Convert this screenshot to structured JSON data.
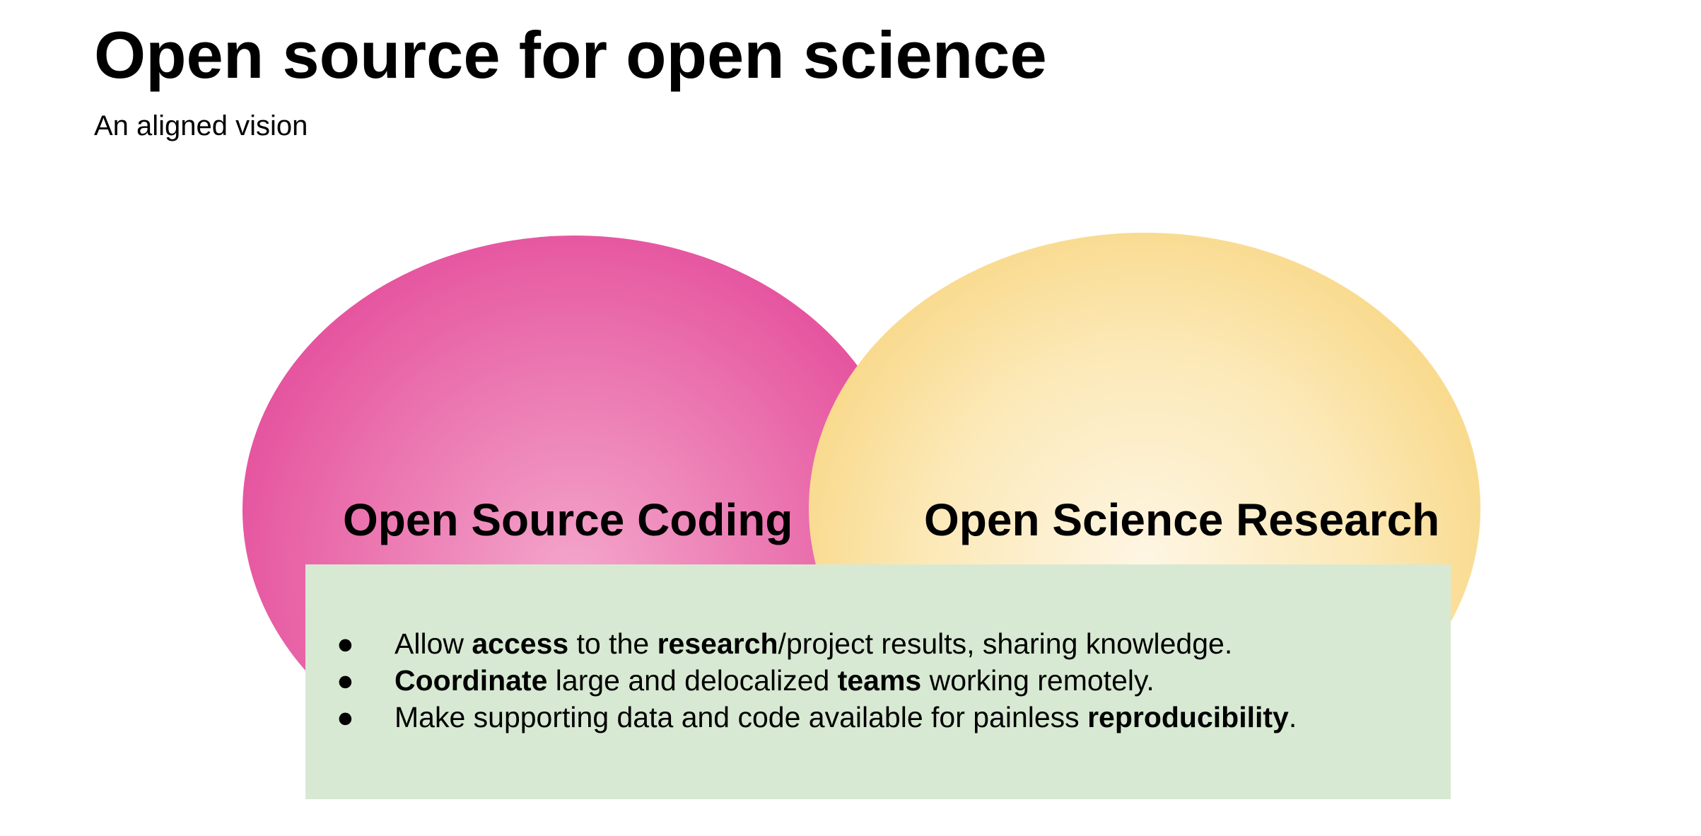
{
  "title": "Open source for open science",
  "subtitle": "An aligned vision",
  "diagram": {
    "left_circle": {
      "label": "Open Source Coding",
      "color": "#e5509d"
    },
    "right_circle": {
      "label": "Open Science Research",
      "color": "#f6d27a"
    },
    "panel_color": "#d8e9d3",
    "bullet_glyph": "●",
    "bullets": [
      {
        "segments": [
          "Allow ",
          "access",
          " to the ",
          "research",
          "/project results, sharing knowledge."
        ]
      },
      {
        "segments": [
          "Coordinate",
          " large and delocalized ",
          "teams",
          " working remotely."
        ]
      },
      {
        "segments": [
          "Make supporting data and code available for painless ",
          "reproducibility",
          "."
        ]
      }
    ]
  }
}
